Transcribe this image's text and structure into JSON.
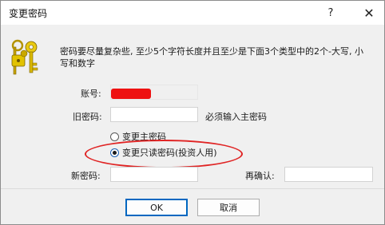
{
  "window": {
    "title": "变更密码",
    "help_label": "?",
    "close_label": "✕"
  },
  "dialog": {
    "description": "密码要尽量复杂些, 至少5个字符长度并且至少是下面3个类型中的2个-大写, 小写和数字",
    "account": {
      "label": "账号:",
      "value": ""
    },
    "old_password": {
      "label": "旧密码:",
      "value": "",
      "hint": "必须输入主密码"
    },
    "mode_options": [
      {
        "label": "变更主密码",
        "selected": false
      },
      {
        "label": "变更只读密码(投资人用)",
        "selected": true
      }
    ],
    "new_password": {
      "label": "新密码:",
      "value": ""
    },
    "confirm_password": {
      "label": "再确认:",
      "value": ""
    }
  },
  "buttons": {
    "ok": "OK",
    "cancel": "取消"
  },
  "colors": {
    "annotation": "#e02424",
    "redaction": "#ee1111",
    "accent": "#0067c0"
  }
}
